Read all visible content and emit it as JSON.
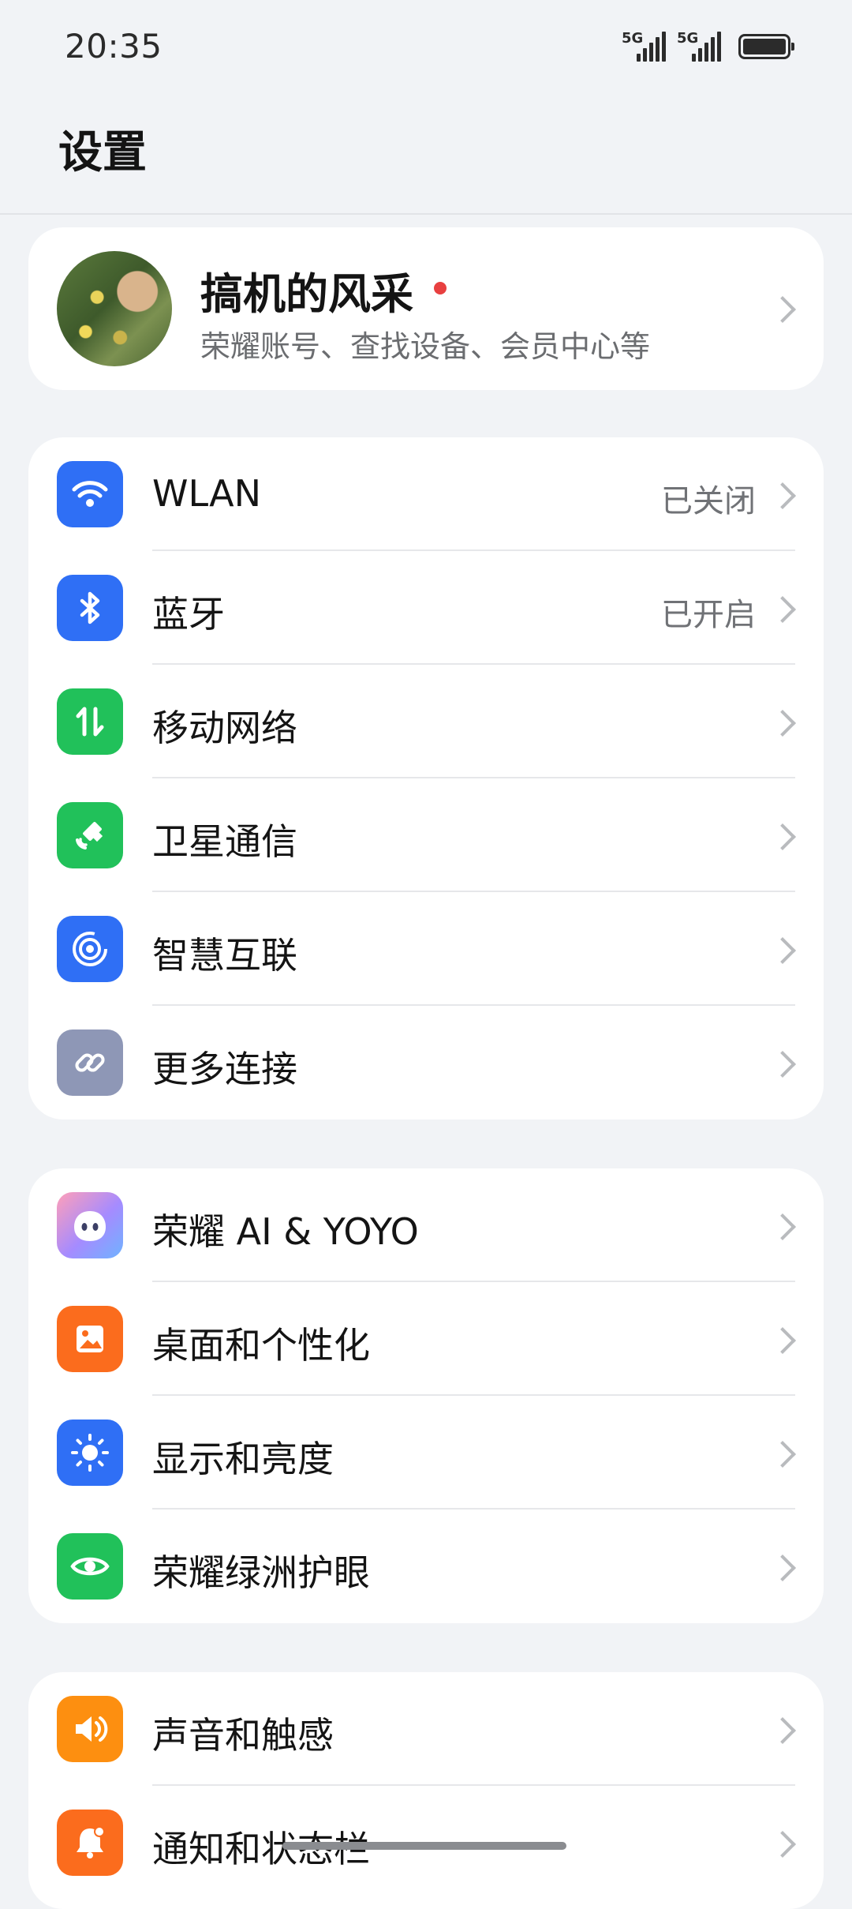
{
  "status_bar": {
    "time": "20:35",
    "sim1_tag": "5G",
    "sim2_tag": "5G",
    "battery_level_percent": 100
  },
  "header": {
    "title": "设置"
  },
  "account": {
    "name": "搞机的风采",
    "subtitle": "荣耀账号、查找设备、会员中心等",
    "has_notification_dot": true
  },
  "sections": {
    "connect": [
      {
        "label": "WLAN",
        "value": "已关闭",
        "icon": "wifi-icon",
        "color": "#2f6ff5"
      },
      {
        "label": "蓝牙",
        "value": "已开启",
        "icon": "bluetooth-icon",
        "color": "#2f6ff5"
      },
      {
        "label": "移动网络",
        "value": "",
        "icon": "mobile-data-icon",
        "color": "#21c15a"
      },
      {
        "label": "卫星通信",
        "value": "",
        "icon": "satellite-icon",
        "color": "#21c15a"
      },
      {
        "label": "智慧互联",
        "value": "",
        "icon": "smart-connect-icon",
        "color": "#2f6ff5"
      },
      {
        "label": "更多连接",
        "value": "",
        "icon": "link-icon",
        "color": "#8e97b6"
      }
    ],
    "ai": [
      {
        "label": "荣耀 AI & YOYO",
        "value": "",
        "icon": "yoyo-icon",
        "color": "#8b7cf6"
      },
      {
        "label": "桌面和个性化",
        "value": "",
        "icon": "picture-icon",
        "color": "#fb6c1d"
      },
      {
        "label": "显示和亮度",
        "value": "",
        "icon": "brightness-icon",
        "color": "#2f6ff5"
      },
      {
        "label": "荣耀绿洲护眼",
        "value": "",
        "icon": "eye-icon",
        "color": "#21c15a"
      }
    ],
    "sound": [
      {
        "label": "声音和触感",
        "value": "",
        "icon": "speaker-icon",
        "color": "#fd8f10"
      },
      {
        "label": "通知和状态栏",
        "value": "",
        "icon": "bell-icon",
        "color": "#fb6c1d"
      }
    ]
  }
}
